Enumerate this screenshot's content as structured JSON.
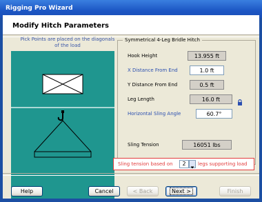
{
  "window": {
    "title": "Rigging Pro Wizard"
  },
  "page": {
    "title": "Modify Hitch Parameters",
    "pick_note": "Pick Points are placed on the diagonals of the load"
  },
  "hitch": {
    "group_label": "Symmetrical 4-Leg Bridle Hitch",
    "hook_height": {
      "label": "Hook Height",
      "value": "13.955  ft"
    },
    "x_distance": {
      "label": "X Distance From End",
      "value": "1.0  ft"
    },
    "y_distance": {
      "label": "Y Distance From End",
      "value": "0.5  ft"
    },
    "leg_length": {
      "label": "Leg Length",
      "value": "16.0  ft"
    },
    "sling_angle": {
      "label": "Horizontal Sling Angle",
      "value": "60.7°"
    },
    "sling_tension": {
      "label": "Sling Tension",
      "value": "16051  lbs"
    }
  },
  "support": {
    "prefix": "Sling tension based on",
    "count": "2",
    "suffix": "legs supporting load"
  },
  "buttons": {
    "help": "Help",
    "cancel": "Cancel",
    "back": "< Back",
    "next": "Next >",
    "finish": "Finish"
  },
  "colors": {
    "diagram_bg": "#1f968f",
    "highlight_border": "#e23b3b",
    "title_bar": "#1c56c4"
  },
  "icons": [
    "lock-icon",
    "hook-icon",
    "chevron-down-icon"
  ]
}
